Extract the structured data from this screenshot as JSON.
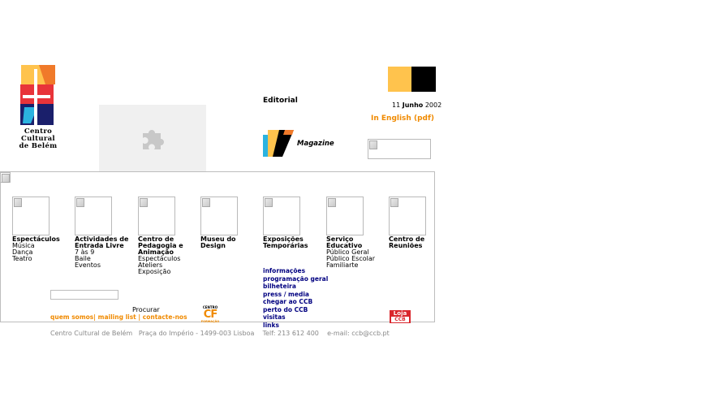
{
  "logo": {
    "line1": "Centro",
    "line2": "Cultural",
    "line3": "de Belém"
  },
  "header": {
    "editorial": "Editorial",
    "date_day": "11",
    "date_month": "Junho",
    "date_year": "2002",
    "english_link": "In English (pdf)",
    "magazine": "Magazine"
  },
  "sections": [
    {
      "title_lines": [
        "Espectáculos"
      ],
      "items": [
        "Música",
        "Dança",
        "Teatro"
      ]
    },
    {
      "title_lines": [
        "Actividades de",
        "Entrada Livre"
      ],
      "items": [
        "7 às 9",
        "Baile",
        "Eventos"
      ]
    },
    {
      "title_lines": [
        "Centro de",
        "Pedagogia e",
        "Animação"
      ],
      "items": [
        "Espectáculos",
        "Ateliers",
        "Exposição"
      ]
    },
    {
      "title_lines": [
        "Museu do",
        "Design"
      ],
      "items": []
    },
    {
      "title_lines": [
        "Exposições",
        "Temporárias"
      ],
      "items": []
    },
    {
      "title_lines": [
        "Serviço",
        "Educativo"
      ],
      "items": [
        "Público Geral",
        "Público Escolar",
        "Familiarte"
      ]
    },
    {
      "title_lines": [
        "Centro de",
        "Reuniões"
      ],
      "items": []
    }
  ],
  "links": [
    "informações",
    "programação geral",
    "bilheteira",
    "press / media",
    "chegar ao CCB",
    "perto do CCB",
    "visitas",
    "links"
  ],
  "search": {
    "button": "Procurar",
    "value": ""
  },
  "bottom_links": {
    "about": "quem somos",
    "mailing": "mailing list",
    "contact": "contacte-nos",
    "sep": "|"
  },
  "cf_logo": {
    "top": "CENTRO",
    "mark": "CF",
    "bottom": "FORMAÇÃO"
  },
  "loja_logo": {
    "top": "Loja",
    "bottom": "CCB"
  },
  "footer": {
    "name": "Centro Cultural de Belém",
    "address": "Praça do Império - 1499-003 Lisboa",
    "phone": "Telf: 213 612 400",
    "email": "e-mail: ccb@ccb.pt"
  },
  "colors": {
    "orange": "#f08a00",
    "navy": "#000080",
    "yellow": "#ffc34d",
    "black": "#000000"
  },
  "icons": {
    "plugin": "puzzle-icon"
  }
}
